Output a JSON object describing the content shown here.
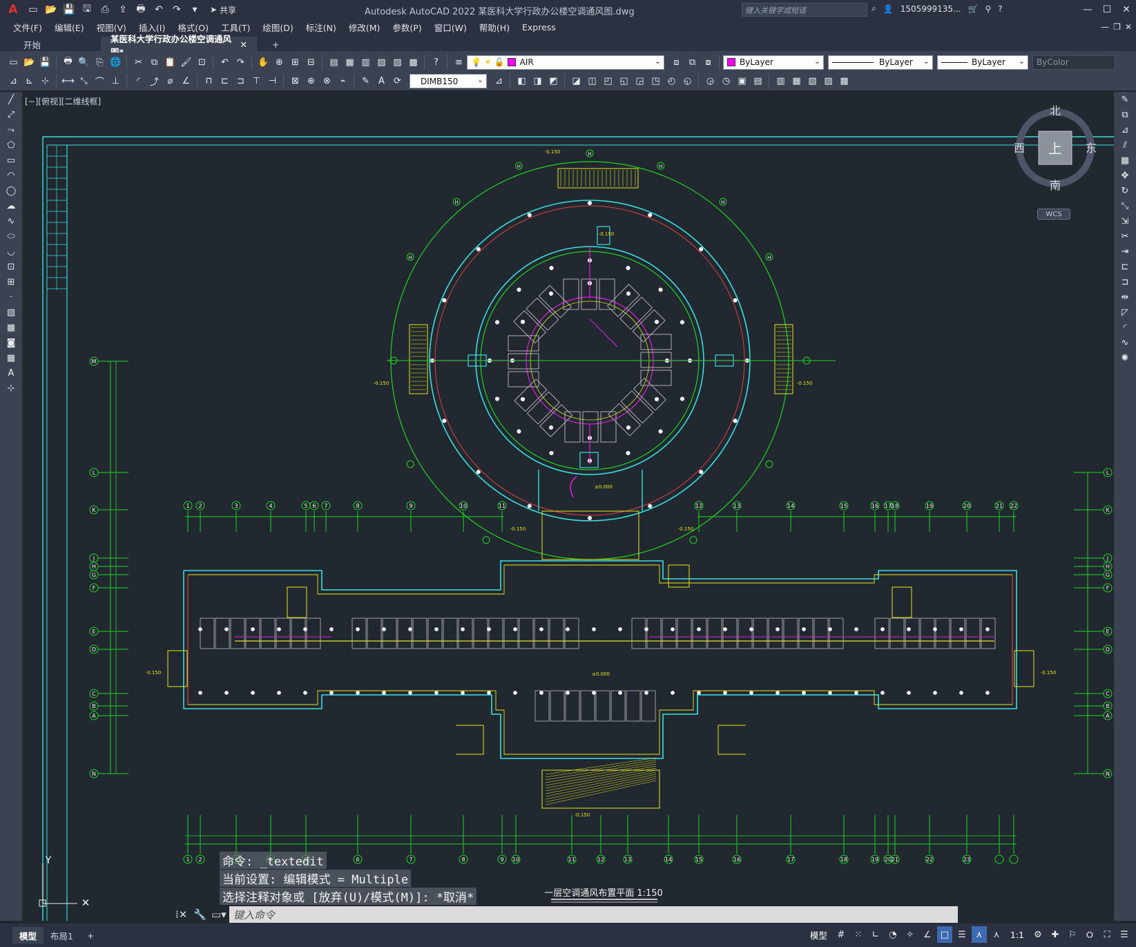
{
  "window": {
    "title": "Autodesk AutoCAD 2022    某医科大学行政办公楼空调通风图.dwg",
    "share": "共享",
    "search_placeholder": "键入关键字或短语",
    "user": "1505999135...",
    "logo": "A"
  },
  "menu": [
    "文件(F)",
    "编辑(E)",
    "视图(V)",
    "插入(I)",
    "格式(O)",
    "工具(T)",
    "绘图(D)",
    "标注(N)",
    "修改(M)",
    "参数(P)",
    "窗口(W)",
    "帮助(H)",
    "Express"
  ],
  "tabs": {
    "start": "开始",
    "active": "某医科大学行政办公楼空调通风图*"
  },
  "toolbar": {
    "layer": "AIR",
    "layer_color": "#ff00ff",
    "color": "ByLayer",
    "linetype": "ByLayer",
    "lineweight": "ByLayer",
    "plotstyle": "ByColor",
    "dimstyle": "DIMB150"
  },
  "viewport": {
    "label": "[−][俯视][二维线框]"
  },
  "viewcube": {
    "north": "北",
    "south": "南",
    "east": "东",
    "west": "西",
    "top": "上",
    "wcs": "WCS"
  },
  "command": {
    "history": [
      "命令:  _textedit",
      "当前设置: 编辑模式 = Multiple",
      "选择注释对象或 [放弃(U)/模式(M)]: *取消*"
    ],
    "placeholder": "键入命令"
  },
  "drawing": {
    "title": "一层空调通风布置平面 1:150",
    "ucs_y": "Y",
    "grid_cols": [
      "1",
      "2",
      "3",
      "4",
      "5",
      "6",
      "7",
      "8",
      "9",
      "10",
      "11",
      "12",
      "13",
      "14",
      "15",
      "16",
      "17",
      "18",
      "19",
      "20",
      "21",
      "22",
      "23"
    ],
    "grid_rows": [
      "M",
      "L",
      "K",
      "J",
      "H",
      "G",
      "F",
      "E",
      "D",
      "C",
      "B",
      "A",
      "N"
    ]
  },
  "layout_tabs": {
    "model": "模型",
    "layout1": "布局1",
    "add": "+"
  },
  "status": {
    "model": "模型",
    "scale": "1:1"
  },
  "colors": {
    "cyan": "#38e0e0",
    "green": "#1fd61f",
    "yellow": "#e6e61a",
    "magenta": "#e01ee0",
    "red": "#e04040",
    "white": "#f0f0f0",
    "bg": "#212830"
  }
}
